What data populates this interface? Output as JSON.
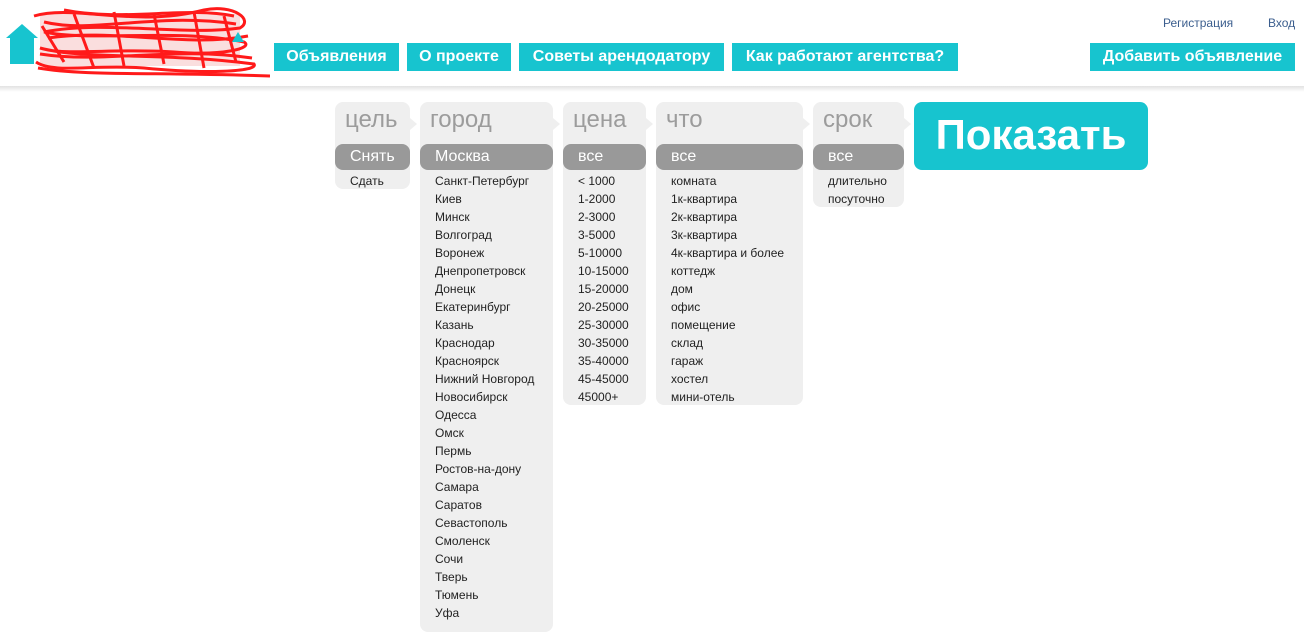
{
  "header": {
    "nav": [
      {
        "label": "Объявления"
      },
      {
        "label": "О проекте"
      },
      {
        "label": "Советы арендодатору"
      },
      {
        "label": "Как работают агентства?"
      }
    ],
    "add_button": "Добавить объявление",
    "register_link": "Регистрация",
    "login_link": "Вход",
    "accent_color": "#17c4cf"
  },
  "filters": {
    "goal": {
      "title": "цель",
      "selected": "Снять",
      "options": [
        "Сдать"
      ]
    },
    "city": {
      "title": "город",
      "selected": "Москва",
      "options": [
        "Санкт-Петербург",
        "Киев",
        "Минск",
        "Волгоград",
        "Воронеж",
        "Днепропетровск",
        "Донецк",
        "Екатеринбург",
        "Казань",
        "Краснодар",
        "Красноярск",
        "Нижний Новгород",
        "Новосибирск",
        "Одесса",
        "Омск",
        "Пермь",
        "Ростов-на-дону",
        "Самара",
        "Саратов",
        "Севастополь",
        "Смоленск",
        "Сочи",
        "Тверь",
        "Тюмень",
        "Уфа"
      ]
    },
    "price": {
      "title": "цена",
      "selected": "все",
      "options": [
        "< 1000",
        "1-2000",
        "2-3000",
        "3-5000",
        "5-10000",
        "10-15000",
        "15-20000",
        "20-25000",
        "25-30000",
        "30-35000",
        "35-40000",
        "45-45000",
        "45000+"
      ]
    },
    "what": {
      "title": "что",
      "selected": "все",
      "options": [
        "комната",
        "1к-квартира",
        "2к-квартира",
        "3к-квартира",
        "4к-квартира и более",
        "коттедж",
        "дом",
        "офис",
        "помещение",
        "склад",
        "гараж",
        "хостел",
        "мини-отель"
      ]
    },
    "term": {
      "title": "срок",
      "selected": "все",
      "options": [
        "длительно",
        "посуточно"
      ]
    }
  },
  "show_button": "Показать"
}
